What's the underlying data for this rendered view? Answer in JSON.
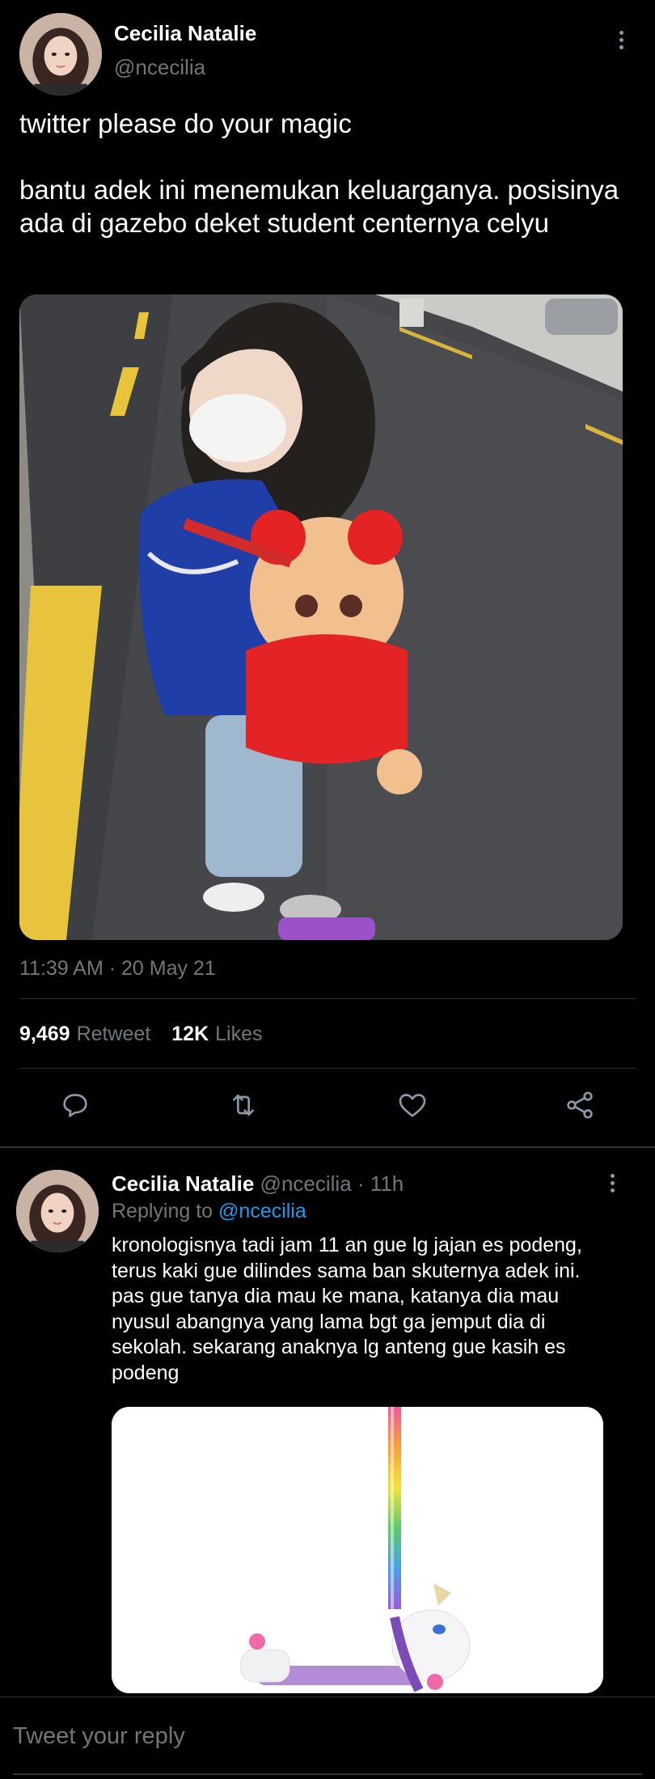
{
  "tweet": {
    "author_name": "Cecilia Natalie",
    "author_handle": "@ncecilia",
    "text": "twitter please do your magic\n\nbantu adek ini menemukan keluarganya. posisinya ada di gazebo deket student centernya celyu",
    "timestamp": "11:39 AM · 20 May 21",
    "retweet_count": "9,469",
    "retweet_label": "Retweet",
    "like_count": "12K",
    "like_label": "Likes"
  },
  "actions": {
    "reply_icon": "speech-bubble-icon",
    "retweet_icon": "retweet-arrows-icon",
    "like_icon": "heart-icon",
    "share_icon": "share-nodes-icon"
  },
  "reply": {
    "author_name": "Cecilia Natalie",
    "author_handle": "@ncecilia",
    "separator": "·",
    "age": "11h",
    "replying_prefix": "Replying to",
    "replying_to": "@ncecilia",
    "text": "kronologisnya tadi jam 11 an gue lg jajan es podeng, terus kaki gue dilindes sama ban skuternya adek ini. pas gue tanya dia mau ke mana, katanya dia mau nyusul abangnya yang lama bgt ga jemput dia di sekolah. sekarang anaknya lg anteng gue kasih es podeng"
  },
  "composer": {
    "placeholder": "Tweet your reply"
  },
  "colors": {
    "background": "#000000",
    "text": "#e7e9ea",
    "secondary": "#71767b",
    "link": "#1d9bf0",
    "divider": "#2f3336"
  }
}
